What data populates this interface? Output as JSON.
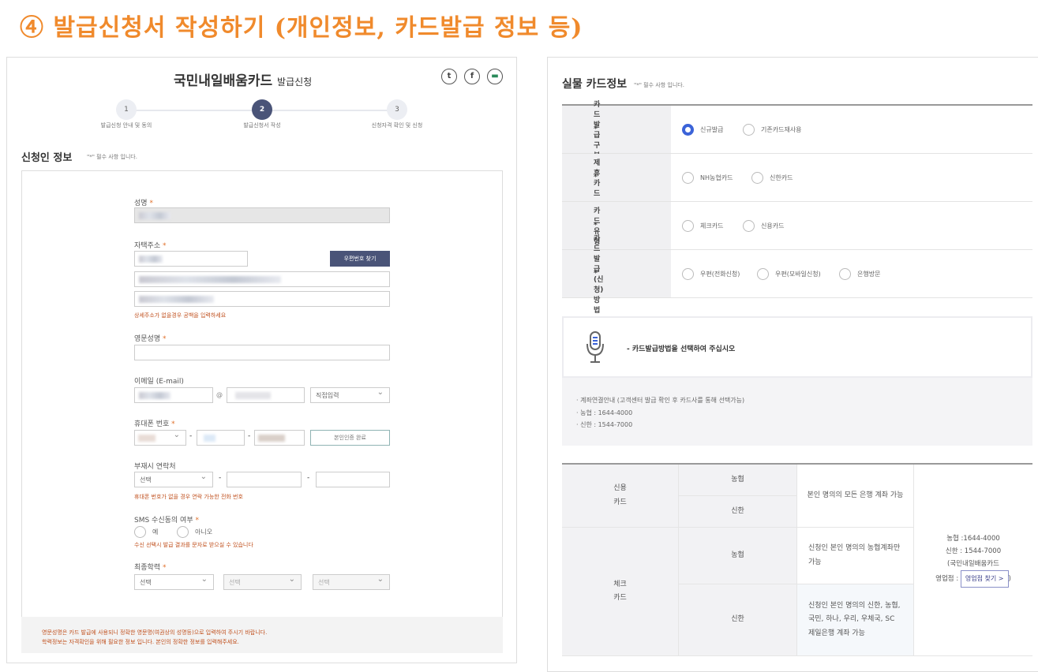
{
  "heading": "④ 발급신청서 작성하기 (개인정보, 카드발급 정보 등)",
  "left": {
    "title_main": "국민내일배움카드",
    "title_sub": "발급신청",
    "social_icons": [
      "twitter-icon",
      "facebook-icon",
      "share-icon"
    ],
    "steps": [
      {
        "num": "1",
        "label": "발급신청 안내 및 동의"
      },
      {
        "num": "2",
        "label": "발급신청서 작성"
      },
      {
        "num": "3",
        "label": "신청자격 확인 및 신청"
      }
    ],
    "active_step": 2,
    "section_title": "신청인 정보",
    "required_note": "\"*\" 필수 사항 입니다.",
    "fields": {
      "name": "성명",
      "address": "자택주소",
      "zip_button": "우편번호 찾기",
      "address_hint": "상세주소가 없을경우 공백을 입력하세요",
      "eng_name": "영문성명",
      "email": "이메일 (E-mail)",
      "email_at": "@",
      "email_domain_select": "직접입력",
      "mobile": "휴대폰 번호",
      "verify_button": "본인인증 완료",
      "alt_contact": "부재시 연락처",
      "alt_select": "선택",
      "alt_hint": "휴대폰 번호가 없을 경우 연락 가능한 전화 번호",
      "sms": "SMS 수신동의 여부",
      "sms_yes": "예",
      "sms_no": "아니오",
      "sms_hint": "수신 선택시 발급 결과를 문자로 받으실 수 있습니다",
      "education": "최종학력",
      "edu_select": "선택",
      "dash": "-",
      "star": "*"
    },
    "footer_notes": [
      "영문성명은 카드 발급에 사용되니 정확한 영문명(여권상의 성명등)으로 입력하여 주시기 바랍니다.",
      "학력정보는 자격확인을 위해 필요한 정보 입니다. 본인의 정확한 정보를 입력해주세요."
    ]
  },
  "right": {
    "section_title": "실물 카드정보",
    "required_note": "\"*\" 필수 사항 입니다.",
    "rows": [
      {
        "label": "카드 발급구분",
        "options": [
          "신규발급",
          "기존카드재사용"
        ],
        "selected": 0
      },
      {
        "label": "제휴카드",
        "options": [
          "NH농협카드",
          "신한카드"
        ],
        "selected": -1
      },
      {
        "label": "카드유형",
        "options": [
          "체크카드",
          "신용카드"
        ],
        "selected": -1
      },
      {
        "label": "카드발급(신청)방법",
        "options": [
          "우편(전화신청)",
          "우편(모바일신청)",
          "은행방문"
        ],
        "selected": -1
      }
    ],
    "notice": "- 카드발급방법을 선택하여 주십시오",
    "info": [
      "계좌연결안내 (고객센터 발급 확인 후 카드사를 통해 선택가능)",
      "농협 : 1644-4000",
      "신한 : 1544-7000"
    ],
    "table": {
      "credit": "신용\n카드",
      "check": "체크\n카드",
      "nh": "농협",
      "shinhan": "신한",
      "credit_desc": "본인 명의의 모든 은행 계좌 가능",
      "check_nh_desc": "신청인 본인 명의의 농협계좌만 가능",
      "check_sh_desc": "신청인 본인 명의의 신한, 농협, 국민, 하나, 우리, 우체국, SC 제일은행 계좌 가능",
      "contact": [
        "농협 :1644-4000",
        "신한 : 1544-7000",
        "(국민내일배움카드"
      ],
      "branch_label": "영업점 :",
      "branch_button": "영업점 찾기 >",
      "close_paren": ")"
    }
  }
}
